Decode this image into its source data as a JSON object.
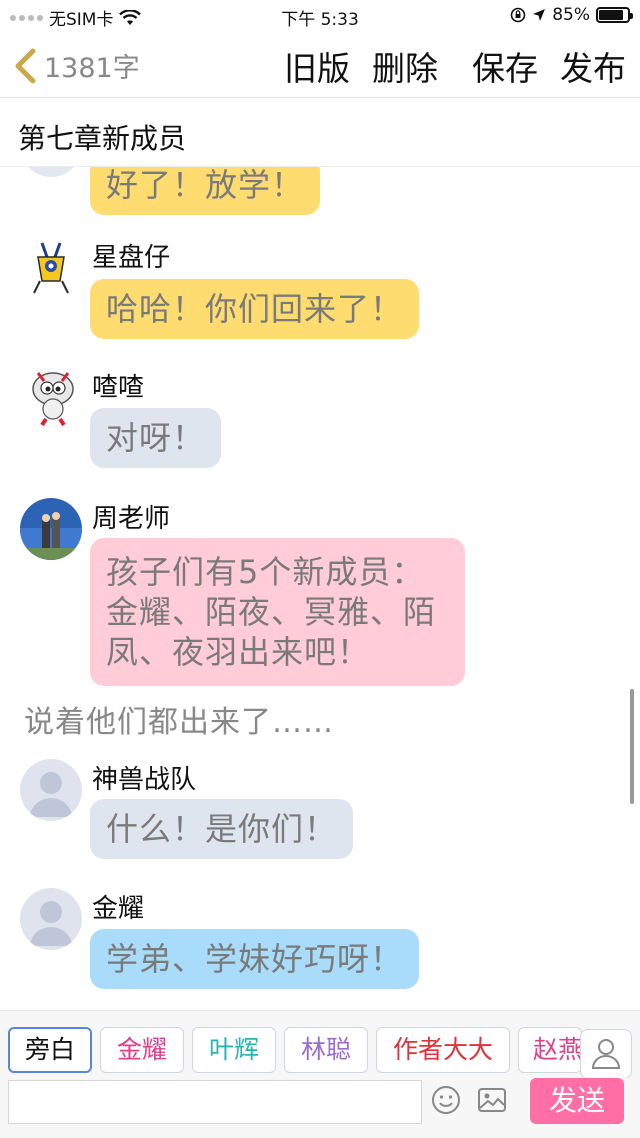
{
  "status_bar": {
    "carrier": "无SIM卡",
    "time": "下午 5:33",
    "battery": "85%",
    "battery_level": 0.85
  },
  "header": {
    "word_count": "1381字",
    "actions": [
      "旧版",
      "删除",
      "保存",
      "发布"
    ]
  },
  "chapter_title": "第七章新成员",
  "messages": [
    {
      "speaker": "",
      "text": "好了！放学！",
      "color": "#ffdc70"
    },
    {
      "speaker": "星盘仔",
      "text": "哈哈！你们回来了！",
      "color": "#ffdc70"
    },
    {
      "speaker": "喳喳",
      "text": "对呀！",
      "color": "#dfe5ee"
    },
    {
      "speaker": "周老师",
      "text_lines": [
        "孩子们有5个新成员：",
        "金耀、陌夜、冥雅、陌",
        "凤、夜羽出来吧！"
      ],
      "color": "#ffccd8"
    },
    {
      "narration": "说着他们都出来了……"
    },
    {
      "speaker": "神兽战队",
      "text": "什么！是你们！",
      "color": "#dfe5ee"
    },
    {
      "speaker": "金耀",
      "text": "学弟、学妹好巧呀！",
      "color": "#a8dcfa"
    }
  ],
  "characters": [
    {
      "label": "旁白",
      "color": "#111111"
    },
    {
      "label": "金耀",
      "color": "#e0408a"
    },
    {
      "label": "叶辉",
      "color": "#2bb3b3"
    },
    {
      "label": "林聪",
      "color": "#9a6ad0"
    },
    {
      "label": "作者大大",
      "color": "#e0303a"
    },
    {
      "label": "赵燕",
      "color": "#e0408a"
    }
  ],
  "input": {
    "placeholder": "",
    "value": ""
  },
  "send_label": "发送",
  "icons": [
    "back-chevron-icon",
    "wifi-icon",
    "lock-rotation-icon",
    "location-arrow-icon",
    "battery-icon",
    "person-icon",
    "emoji-icon",
    "image-icon"
  ]
}
